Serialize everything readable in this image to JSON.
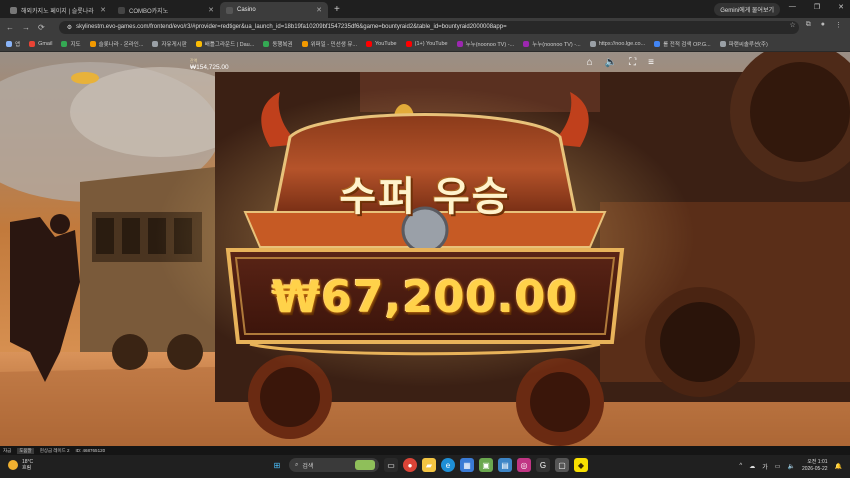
{
  "browser": {
    "tabs": [
      {
        "label": "해외카지노 페이지 | 슬롯나라",
        "active": false
      },
      {
        "label": "COMBO카지노",
        "active": false
      },
      {
        "label": "Casino",
        "active": true
      }
    ],
    "new_tab": "+",
    "gemini_label": "Gemini에게 물어보기",
    "url": "skylinestm.evo-games.com/frontend/evo/r3/#provider=redtiger&ua_launch_id=18b19fa10209bf1547235df6&game=bountyraid2&table_id=bountyraid2000008app=",
    "bookmarks": [
      {
        "label": "앱",
        "color": "#8ab4f8"
      },
      {
        "label": "Gmail",
        "color": "#ea4335"
      },
      {
        "label": "지도",
        "color": "#34a853"
      },
      {
        "label": "슬롯나라 - 온라인...",
        "color": "#f29900"
      },
      {
        "label": "자유게시판",
        "color": "#9aa0a6"
      },
      {
        "label": "배틀그라운드 | Dau...",
        "color": "#fbbc04"
      },
      {
        "label": "동행복권",
        "color": "#34a853"
      },
      {
        "label": "위퍼일 - 민선생 뮤...",
        "color": "#f29900"
      },
      {
        "label": "YouTube",
        "color": "#ff0000"
      },
      {
        "label": "(1+) YouTube",
        "color": "#ff0000"
      },
      {
        "label": "누누(noonoo TV) -...",
        "color": "#9c27b0"
      },
      {
        "label": "누누(noonoo TV) -...",
        "color": "#9c27b0"
      },
      {
        "label": "https://noo.lge.co...",
        "color": "#9aa0a6"
      },
      {
        "label": "롤 전적 검색 OP.G...",
        "color": "#4285f4"
      },
      {
        "label": "파랜씨솔루션(주)",
        "color": "#9aa0a6"
      }
    ]
  },
  "game": {
    "balance_label": "잔액",
    "balance_value": "₩154,725.00",
    "win_title": "수퍼 우승",
    "win_amount": "₩67,200.00"
  },
  "status_bar": {
    "item1": "자금",
    "item2": "도움말",
    "item3": "현상금 레이드 2",
    "item4": "ID: 468765120"
  },
  "taskbar": {
    "weather_temp": "18°C",
    "weather_desc": "흐림",
    "search_placeholder": "검색",
    "ime": "가",
    "time": "오전 1:01",
    "date": "2026-05-22"
  }
}
